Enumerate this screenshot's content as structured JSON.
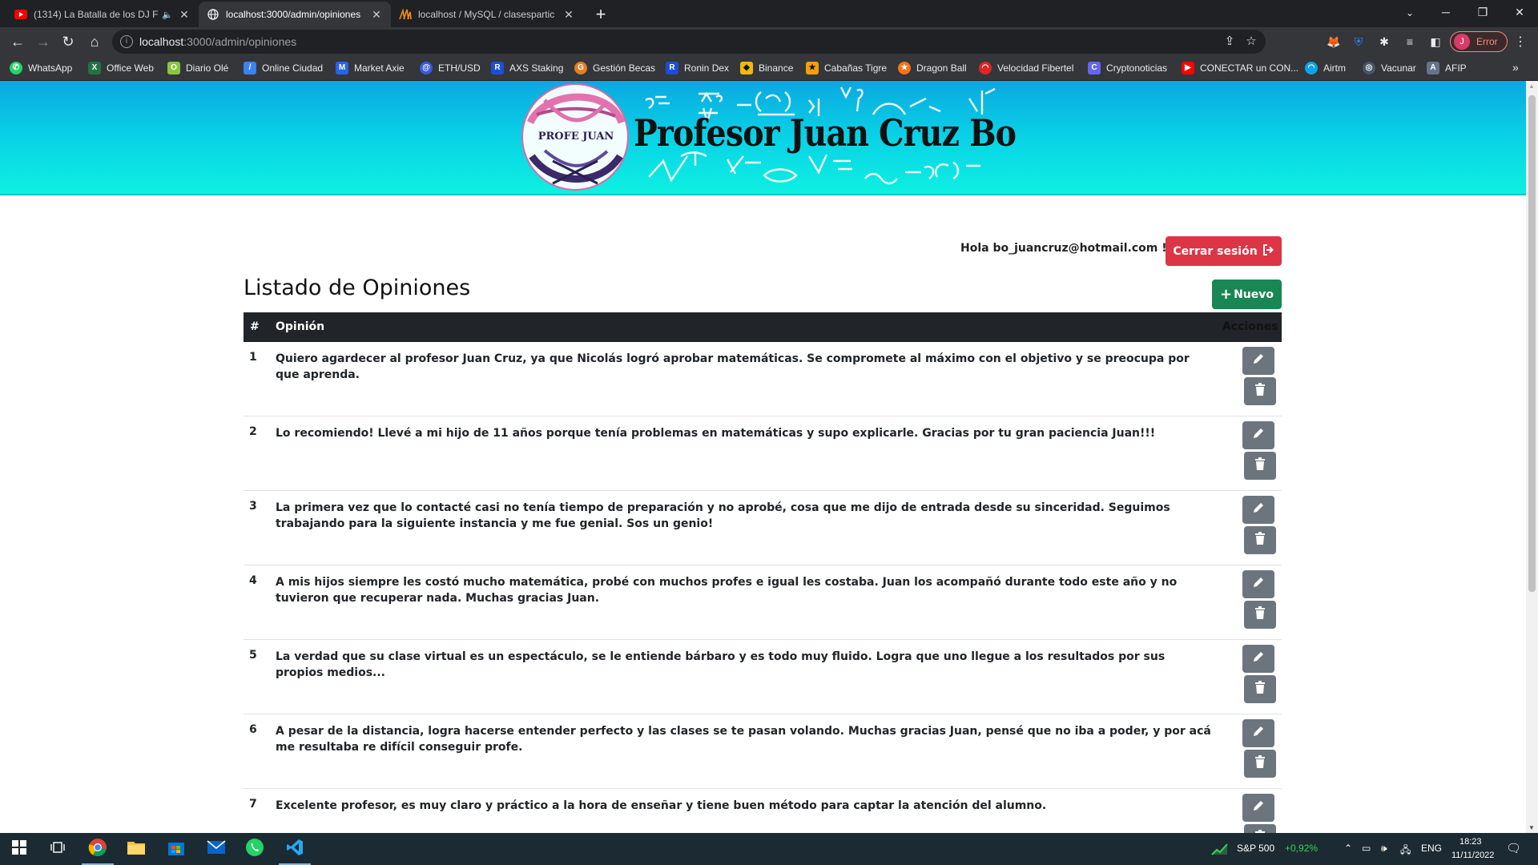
{
  "browser": {
    "tabs": [
      {
        "title": "(1314) La Batalla de los DJ Fi",
        "icon": "youtube-icon"
      },
      {
        "title": "localhost:3000/admin/opiniones",
        "icon": "globe-icon"
      },
      {
        "title": "localhost / MySQL / clasespartic",
        "icon": "phpmyadmin-icon"
      }
    ],
    "url_host": "localhost",
    "url_path": ":3000/admin/opiniones",
    "profile_label": "Error",
    "profile_initial": "J"
  },
  "bookmarks": [
    {
      "label": "WhatsApp",
      "color": "#25d366"
    },
    {
      "label": "Office Web",
      "color": "#217346"
    },
    {
      "label": "Diario Olé",
      "color": "#8bc53f"
    },
    {
      "label": "Online Ciudad",
      "color": "#3b82f6"
    },
    {
      "label": "Market Axie",
      "color": "#2563eb"
    },
    {
      "label": "ETH/USD",
      "color": "#3b5bdb"
    },
    {
      "label": "AXS Staking",
      "color": "#1d4ed8"
    },
    {
      "label": "Gestión Becas",
      "color": "#e67e22"
    },
    {
      "label": "Ronin Dex",
      "color": "#1d4ed8"
    },
    {
      "label": "Binance",
      "color": "#f0b90b"
    },
    {
      "label": "Cabañas Tigre",
      "color": "#f59e0b"
    },
    {
      "label": "Dragon Ball",
      "color": "#f97316"
    },
    {
      "label": "Velocidad Fibertel",
      "color": "#dc2626"
    },
    {
      "label": "Cryptonoticias",
      "color": "#6366f1"
    },
    {
      "label": "CONECTAR un CON...",
      "color": "#ff0000"
    },
    {
      "label": "Airtm",
      "color": "#0ea5e9"
    },
    {
      "label": "Vacunar",
      "color": "#475569"
    },
    {
      "label": "AFIP",
      "color": "#64748b"
    }
  ],
  "site": {
    "logo_title": "Profesor Juan Cruz Bo",
    "logo_badge": "Profe Juan"
  },
  "header": {
    "greeting": "Hola bo_juancruz@hotmail.com !",
    "logout_label": "Cerrar sesión"
  },
  "main": {
    "title": "Listado de Opiniones",
    "new_label": "Nuevo",
    "columns": [
      "#",
      "Opinión",
      "Acciones"
    ],
    "rows": [
      {
        "id": "1",
        "text": "Quiero agardecer al profesor Juan Cruz, ya que Nicolás logró aprobar matemáticas. Se compromete al máximo con el objetivo y se preocupa por que aprenda."
      },
      {
        "id": "2",
        "text": "Lo recomiendo! Llevé a mi hijo de 11 años porque tenía problemas en matemáticas y supo explicarle. Gracias por tu gran paciencia Juan!!!"
      },
      {
        "id": "3",
        "text": "La primera vez que lo contacté casi no tenía tiempo de preparación y no aprobé, cosa que me dijo de entrada desde su sinceridad. Seguimos trabajando para la siguiente instancia y me fue genial. Sos un genio!"
      },
      {
        "id": "4",
        "text": "A mis hijos siempre les costó mucho matemática, probé con muchos profes e igual les costaba. Juan los acompañó durante todo este año y no tuvieron que recuperar nada. Muchas gracias Juan."
      },
      {
        "id": "5",
        "text": "La verdad que su clase virtual es un espectáculo, se le entiende bárbaro y es todo muy fluido. Logra que uno llegue a los resultados por sus propios medios..."
      },
      {
        "id": "6",
        "text": "A pesar de la distancia, logra hacerse entender perfecto y las clases se te pasan volando. Muchas gracias Juan, pensé que no iba a poder, y por acá me resultaba re difícil conseguir profe."
      },
      {
        "id": "7",
        "text": "Excelente profesor, es muy claro y práctico a la hora de enseñar y tiene buen método para captar la atención del alumno."
      }
    ]
  },
  "taskbar": {
    "stock_name": "S&P 500",
    "stock_change": "+0,92%",
    "language": "ENG",
    "time": "18:23",
    "date": "11/11/2022"
  },
  "colors": {
    "danger": "#dc3545",
    "success": "#198754",
    "secondary": "#6c757d",
    "table_head": "#212529"
  }
}
